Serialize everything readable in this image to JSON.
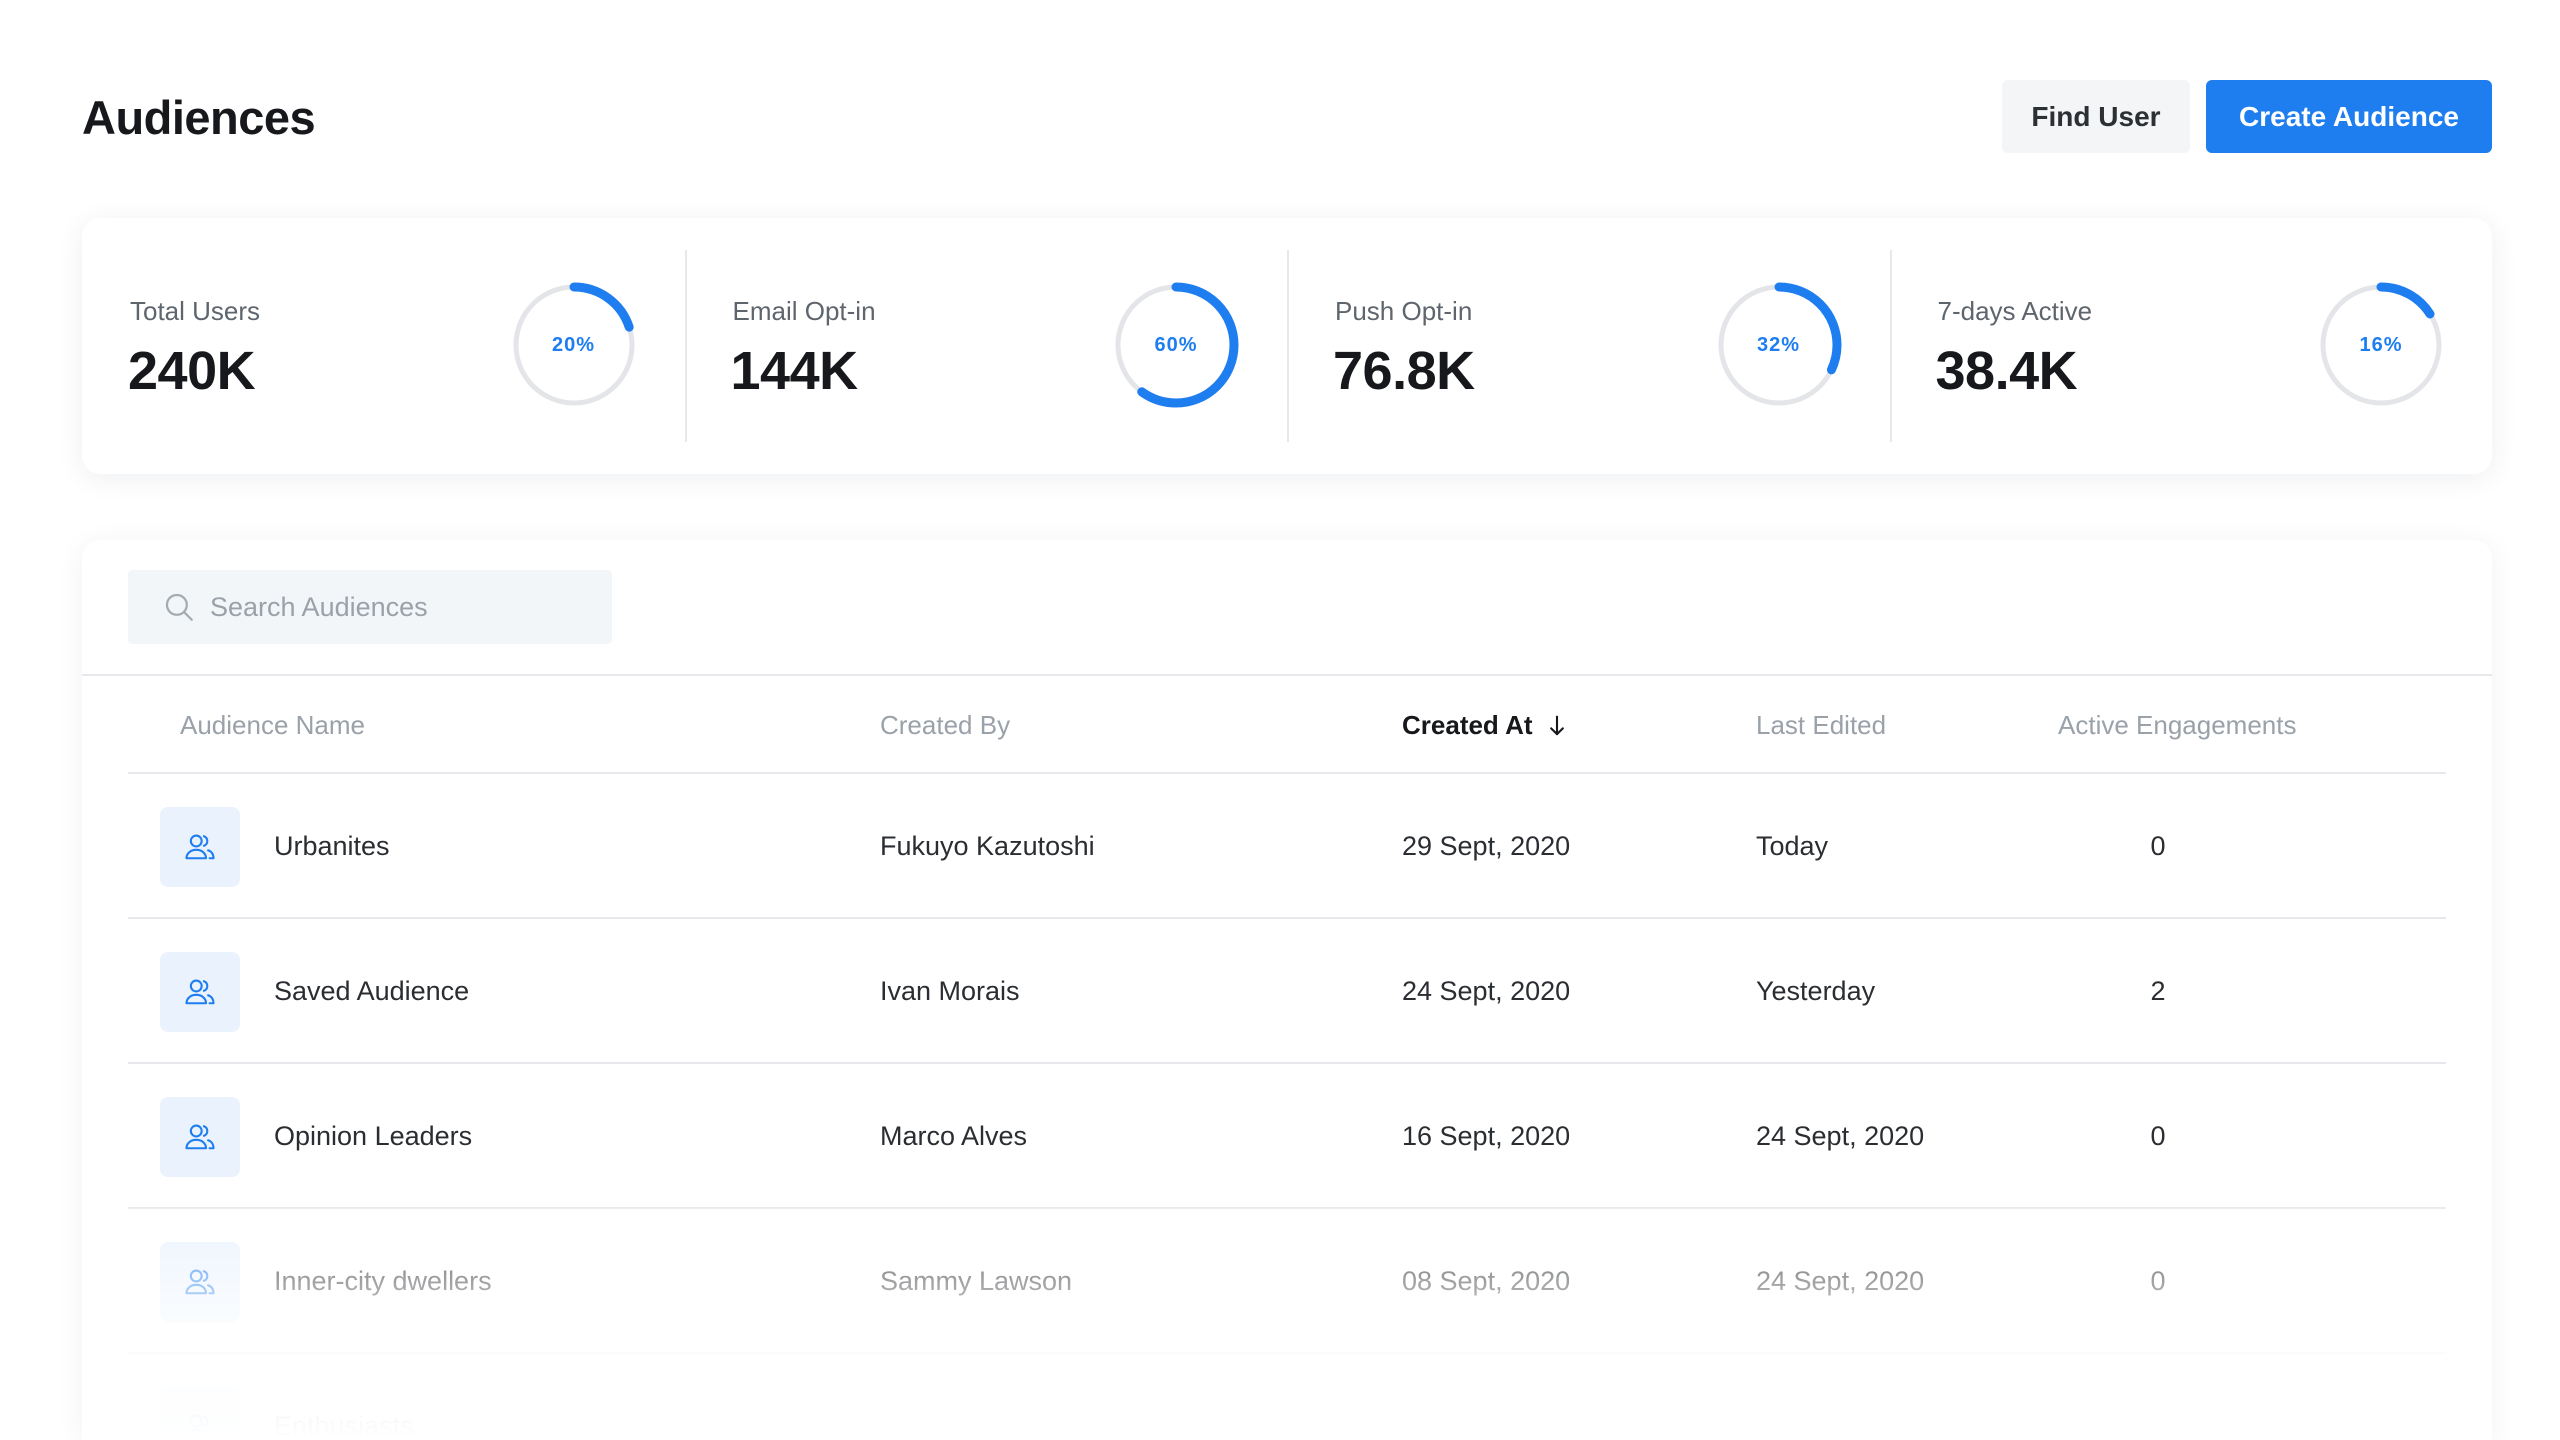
{
  "header": {
    "title": "Audiences",
    "find_user_label": "Find User",
    "create_audience_label": "Create Audience"
  },
  "stats": [
    {
      "label": "Total Users",
      "value": "240K",
      "percent_label": "20%",
      "percent": 0.2
    },
    {
      "label": "Email Opt-in",
      "value": "144K",
      "percent_label": "60%",
      "percent": 0.6
    },
    {
      "label": "Push Opt-in",
      "value": "76.8K",
      "percent_label": "32%",
      "percent": 0.32
    },
    {
      "label": "7-days Active",
      "value": "38.4K",
      "percent_label": "16%",
      "percent": 0.16
    }
  ],
  "search": {
    "placeholder": "Search Audiences",
    "value": ""
  },
  "table": {
    "columns": {
      "name": "Audience Name",
      "created_by": "Created By",
      "created_at": "Created At",
      "last_edited": "Last Edited",
      "engagements": "Active Engagements"
    },
    "sort": {
      "column": "created_at",
      "direction": "descending",
      "icon": "arrow-down-icon"
    },
    "rows": [
      {
        "name": "Urbanites",
        "created_by": "Fukuyo Kazutoshi",
        "created_at": "29 Sept, 2020",
        "last_edited": "Today",
        "engagements": "0"
      },
      {
        "name": "Saved Audience",
        "created_by": "Ivan Morais",
        "created_at": "24 Sept, 2020",
        "last_edited": "Yesterday",
        "engagements": "2"
      },
      {
        "name": "Opinion Leaders",
        "created_by": "Marco Alves",
        "created_at": "16 Sept, 2020",
        "last_edited": "24 Sept, 2020",
        "engagements": "0"
      },
      {
        "name": "Inner-city dwellers",
        "created_by": "Sammy Lawson",
        "created_at": "08 Sept, 2020",
        "last_edited": "24 Sept, 2020",
        "engagements": "0"
      },
      {
        "name": "Enthusiasts",
        "created_by": "",
        "created_at": "",
        "last_edited": "",
        "engagements": ""
      }
    ]
  },
  "colors": {
    "accent": "#1e7ef0",
    "ring_track": "#e3e5e8",
    "icon_bg": "#e9f2fd"
  },
  "icons": {
    "row": "users-group-icon",
    "search": "search-icon"
  }
}
